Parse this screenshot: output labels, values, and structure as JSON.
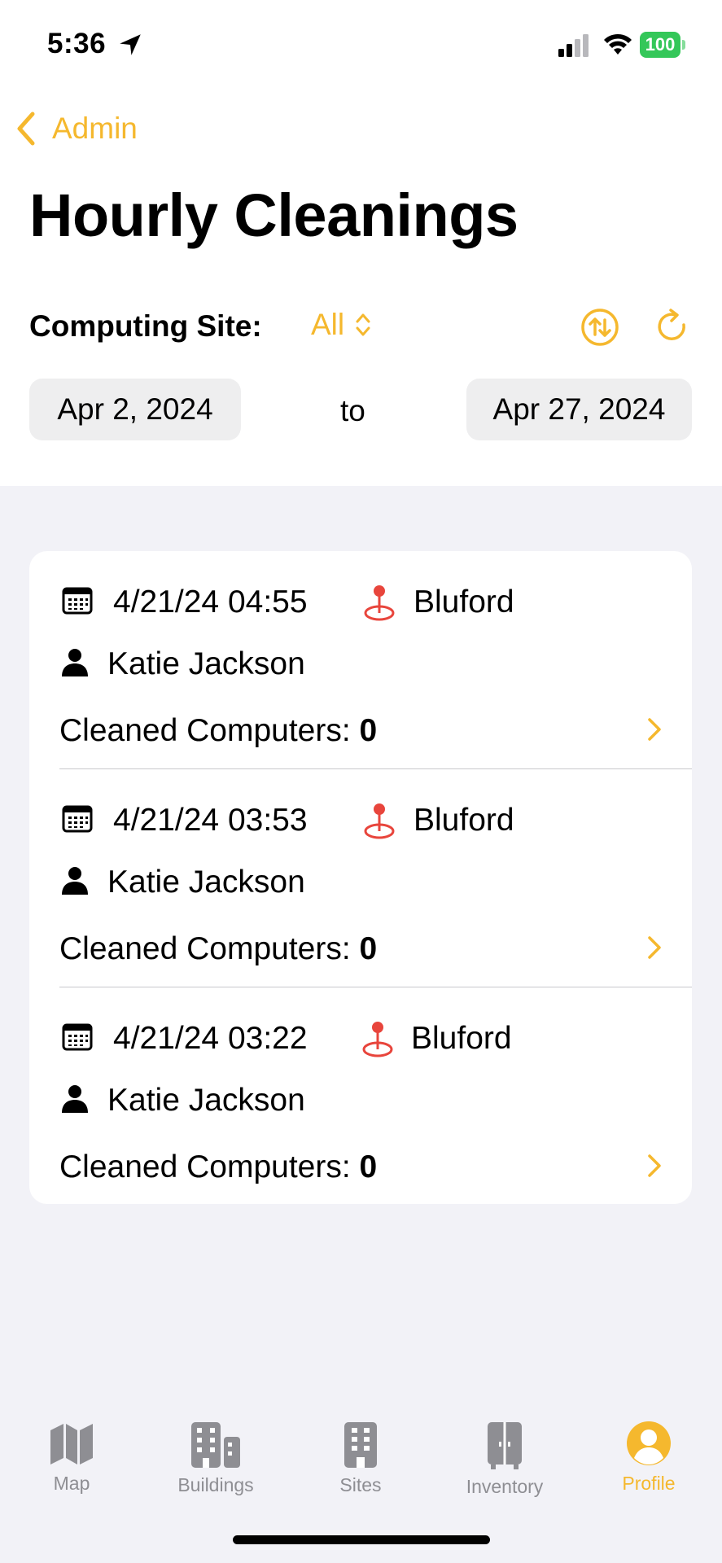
{
  "status_bar": {
    "time": "5:36",
    "battery": "100"
  },
  "nav": {
    "back_label": "Admin",
    "title": "Hourly Cleanings"
  },
  "filters": {
    "site_label": "Computing Site:",
    "site_value": "All",
    "date_from": "Apr 2, 2024",
    "to_label": "to",
    "date_to": "Apr 27, 2024"
  },
  "cleanings": [
    {
      "datetime": "4/21/24 04:55",
      "site": "Bluford",
      "person": "Katie Jackson",
      "count_label": "Cleaned Computers:",
      "count": "0"
    },
    {
      "datetime": "4/21/24 03:53",
      "site": "Bluford",
      "person": "Katie Jackson",
      "count_label": "Cleaned Computers:",
      "count": "0"
    },
    {
      "datetime": "4/21/24 03:22",
      "site": "Bluford",
      "person": "Katie Jackson",
      "count_label": "Cleaned Computers:",
      "count": "0"
    }
  ],
  "tabbar": {
    "active": "Profile",
    "items": [
      {
        "label": "Map",
        "icon": "map-icon"
      },
      {
        "label": "Buildings",
        "icon": "buildings-icon"
      },
      {
        "label": "Sites",
        "icon": "building-icon"
      },
      {
        "label": "Inventory",
        "icon": "cabinet-icon"
      },
      {
        "label": "Profile",
        "icon": "person-circle-icon"
      }
    ]
  },
  "colors": {
    "accent": "#f5b82e",
    "pin": "#e8453c",
    "background": "#f2f2f7",
    "battery": "#34c759",
    "inactive": "#8e8e93"
  }
}
